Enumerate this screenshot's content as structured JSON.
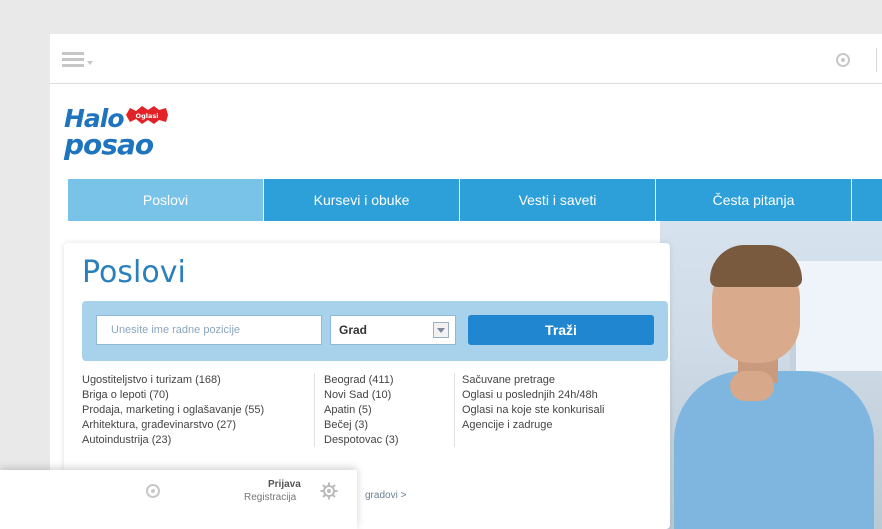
{
  "logo": {
    "word1": "Halo",
    "word2": "posao",
    "badge": "Oglasi"
  },
  "nav": {
    "items": [
      {
        "label": "Poslovi",
        "active": true
      },
      {
        "label": "Kursevi i obuke",
        "active": false
      },
      {
        "label": "Vesti i saveti",
        "active": false
      },
      {
        "label": "Česta pitanja",
        "active": false
      }
    ]
  },
  "panel": {
    "title": "Poslovi",
    "search": {
      "placeholder": "Unesite ime radne pozicije",
      "city_value": "Grad",
      "button_label": "Traži"
    },
    "categories": [
      "Ugostiteljstvo i turizam (168)",
      "Briga o lepoti (70)",
      "Prodaja, marketing i oglašavanje (55)",
      "Arhitektura, građevinarstvo (27)",
      "Autoindustrija (23)"
    ],
    "cities": [
      "Beograd (411)",
      "Novi Sad (10)",
      "Apatin (5)",
      "Bečej (3)",
      "Despotovac (3)"
    ],
    "links": [
      "Sačuvane pretrage",
      "Oglasi u poslednjih 24h/48h",
      "Oglasi na koje ste konkurisali",
      "Agencije i zadruge"
    ],
    "more_cities": "gradovi >"
  },
  "float_bar": {
    "login": "Prijava",
    "register": "Registracija"
  },
  "colors": {
    "brand_blue": "#1f74bf",
    "nav_blue": "#2d9fd9",
    "nav_active": "#79c3e8",
    "search_bar": "#a8d1ec",
    "button_blue": "#1f86cf"
  },
  "icons": [
    "menu-icon",
    "radio-icon",
    "gear-icon",
    "dropdown-arrow-icon"
  ]
}
